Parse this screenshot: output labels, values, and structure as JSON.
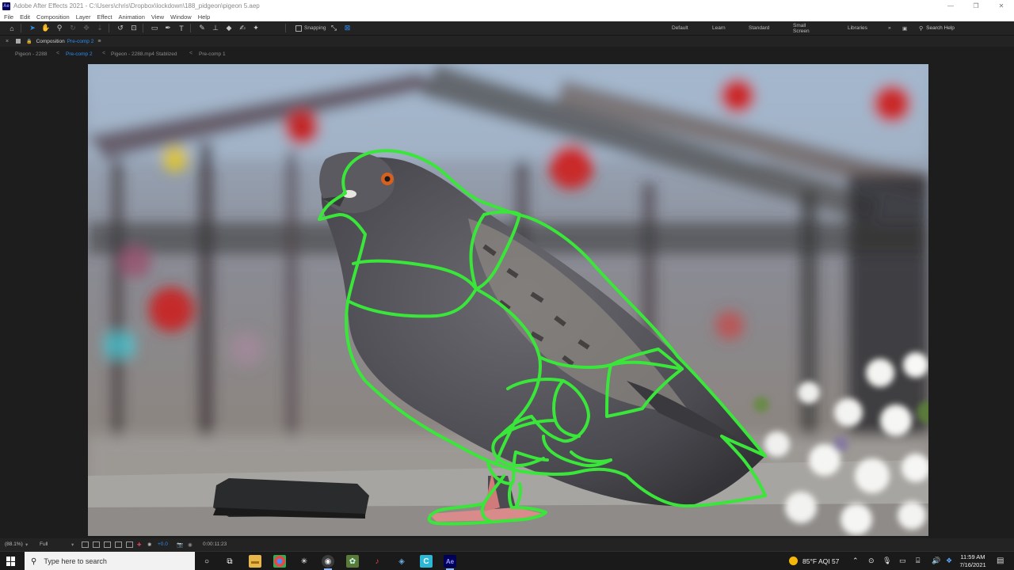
{
  "window": {
    "title": "Adobe After Effects 2021 - C:\\Users\\chris\\Dropbox\\lockdown\\188_pidgeon\\pigeon 5.aep",
    "app_badge": "Ae",
    "minimize": "—",
    "maximize": "❐",
    "close": "✕"
  },
  "menu": [
    "File",
    "Edit",
    "Composition",
    "Layer",
    "Effect",
    "Animation",
    "View",
    "Window",
    "Help"
  ],
  "toolbar": {
    "snapping_label": "Snapping",
    "workspaces": {
      "default": "Default",
      "learn": "Learn",
      "standard": "Standard",
      "small_screen": "Small Screen",
      "libraries": "Libraries",
      "more": "»"
    },
    "search_help": "Search Help"
  },
  "comp_panel": {
    "label": "Composition",
    "name": "Pre-comp 2",
    "close": "×",
    "menu": "≡"
  },
  "breadcrumb": {
    "items": [
      {
        "label": "Pigeon - 2288"
      },
      {
        "label": "Pre-comp 2"
      },
      {
        "label": "Pigeon - 2288.mp4 Stablized"
      },
      {
        "label": "Pre-comp 1"
      }
    ],
    "separator": "<"
  },
  "viewer_footer": {
    "zoom": "(88.1%)",
    "resolution": "Full",
    "exposure": "+0.0",
    "timecode": "0:00:11:23"
  },
  "taskbar": {
    "search_placeholder": "Type here to search",
    "weather": "85°F  AQI 57",
    "time": "11:59 AM",
    "date": "7/16/2021",
    "ae_label": "Ae"
  },
  "colors": {
    "accent": "#2d8ceb",
    "rotoscope_outline": "#39e639"
  }
}
